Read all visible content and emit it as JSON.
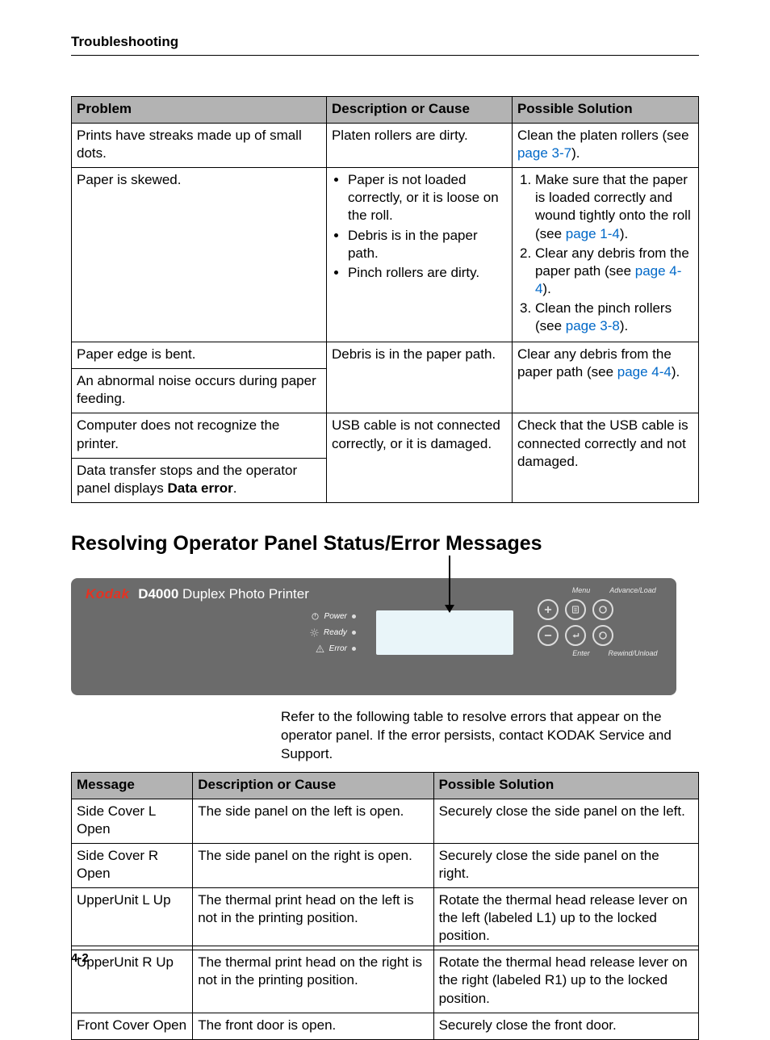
{
  "header": "Troubleshooting",
  "footer": "4-2",
  "table1": {
    "head": {
      "c1": "Problem",
      "c2": "Description or Cause",
      "c3": "Possible Solution"
    },
    "r1": {
      "problem": "Prints have streaks made up of small dots.",
      "desc": "Platen rollers are dirty.",
      "sol_a": "Clean the platen rollers (see ",
      "sol_link": "page 3-7",
      "sol_b": ")."
    },
    "r2": {
      "problem": "Paper is skewed.",
      "desc1": "Paper is not loaded correctly, or it is loose on the roll.",
      "desc2": "Debris is in the paper path.",
      "desc3": "Pinch rollers are dirty.",
      "sol1a": "Make sure that the paper is loaded correctly and wound tightly onto the roll (see ",
      "sol1link": "page 1-4",
      "sol1b": ").",
      "sol2a": "Clear any debris from the paper path (see ",
      "sol2link": "page 4-4",
      "sol2b": ").",
      "sol3a": "Clean the pinch rollers (see ",
      "sol3link": "page 3-8",
      "sol3b": ")."
    },
    "r3": {
      "problem": "Paper edge is bent.",
      "desc": "Debris is in the paper path.",
      "sol_a": "Clear any debris from the paper path (see ",
      "sol_link": "page 4-4",
      "sol_b": ")."
    },
    "r4": {
      "problem": "An abnormal noise occurs during paper feeding."
    },
    "r5": {
      "problem": "Computer does not recognize the printer.",
      "desc": "USB cable is not connected correctly, or it is damaged.",
      "sol": "Check that the USB cable is connected correctly and not damaged."
    },
    "r6": {
      "problem_a": "Data transfer stops and the operator panel displays ",
      "problem_bold": "Data error",
      "problem_b": "."
    }
  },
  "section_title": "Resolving Operator Panel Status/Error Messages",
  "panel": {
    "brand_kodak": "Kodak",
    "brand_model": "D4000",
    "brand_sub": " Duplex Photo Printer",
    "status_power": "Power",
    "status_ready": "Ready",
    "status_error": "Error",
    "lbl_menu": "Menu",
    "lbl_advance": "Advance/Load",
    "lbl_enter": "Enter",
    "lbl_rewind": "Rewind/Unload"
  },
  "panel_note": "Refer to the following table to resolve errors that appear on the operator panel. If the error persists, contact KODAK Service and Support.",
  "table2": {
    "head": {
      "c1": "Message",
      "c2": "Description or Cause",
      "c3": "Possible Solution"
    },
    "rows": [
      {
        "msg": "Side Cover L Open",
        "desc": "The side panel on the left is open.",
        "sol": "Securely close the side panel on the left."
      },
      {
        "msg": "Side Cover R Open",
        "desc": "The side panel on the right is open.",
        "sol": "Securely close the side panel on the right."
      },
      {
        "msg": "UpperUnit L Up",
        "desc": "The thermal print head on the left is not in the printing position.",
        "sol": "Rotate the thermal head release lever on the left (labeled L1) up to the locked position."
      },
      {
        "msg": "UpperUnit R Up",
        "desc": "The thermal print head on the right is not in the printing position.",
        "sol": "Rotate the thermal head release lever on the right (labeled R1) up to the locked position."
      },
      {
        "msg": "Front Cover Open",
        "desc": "The front door is open.",
        "sol": "Securely close the front door."
      }
    ]
  }
}
